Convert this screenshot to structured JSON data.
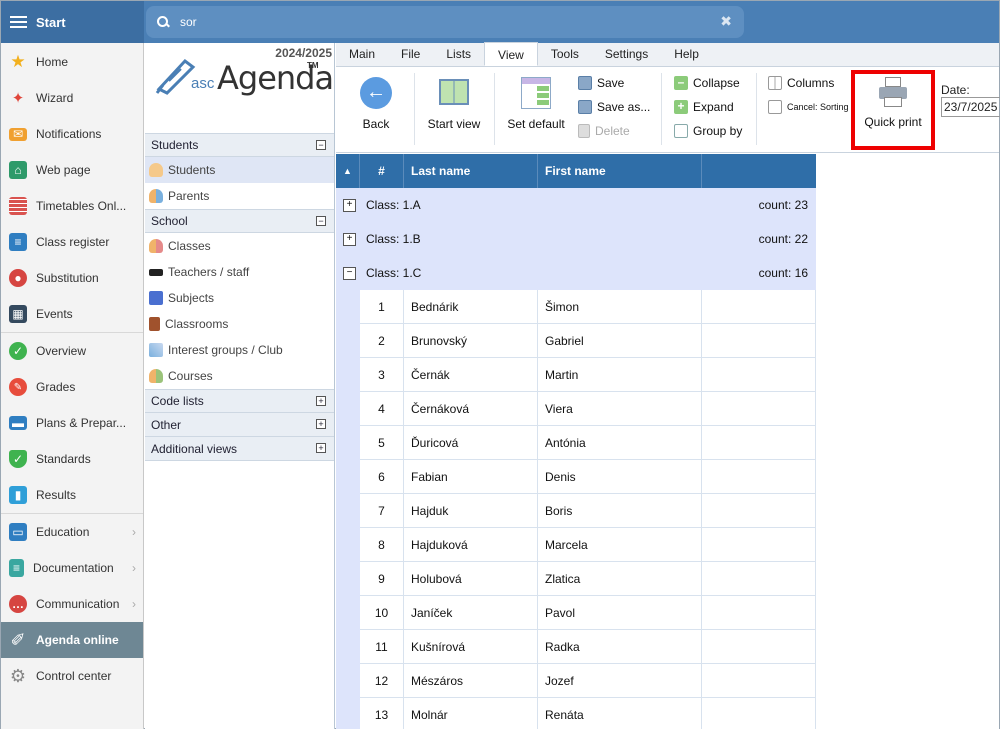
{
  "topbar": {
    "start_label": "Start",
    "search_value": "sor",
    "clear_glyph": "✖"
  },
  "leftnav": {
    "items": [
      {
        "label": "Home",
        "icon": "star-icon",
        "color": "#f2b01e"
      },
      {
        "label": "Wizard",
        "icon": "wand-icon",
        "color": "#e0453a"
      },
      {
        "label": "Notifications",
        "icon": "envelope-icon",
        "color": "#f0a030"
      },
      {
        "label": "Web page",
        "icon": "house-icon",
        "color": "#2e9a6a"
      },
      {
        "label": "Timetables Onl...",
        "icon": "timetable-icon",
        "color": "#d9534f"
      },
      {
        "label": "Class register",
        "icon": "book-icon",
        "color": "#2f7ec1"
      },
      {
        "label": "Substitution",
        "icon": "person-icon",
        "color": "#d64541"
      },
      {
        "label": "Events",
        "icon": "calendar-icon",
        "color": "#34495e"
      },
      {
        "label": "Overview",
        "icon": "check-circle-icon",
        "color": "#3fb34f"
      },
      {
        "label": "Grades",
        "icon": "grades-icon",
        "color": "#e74c3c"
      },
      {
        "label": "Plans & Prepar...",
        "icon": "briefcase-icon",
        "color": "#2f7ec1"
      },
      {
        "label": "Standards",
        "icon": "shield-icon",
        "color": "#3fb34f"
      },
      {
        "label": "Results",
        "icon": "bar-chart-icon",
        "color": "#2f9fd8"
      },
      {
        "label": "Education",
        "icon": "open-book-icon",
        "color": "#2f7ec1"
      },
      {
        "label": "Documentation",
        "icon": "document-icon",
        "color": "#3aa7a0"
      },
      {
        "label": "Communication",
        "icon": "chat-icon",
        "color": "#d64541"
      },
      {
        "label": "Agenda online",
        "icon": "pen-icon",
        "color": "#ffffff"
      },
      {
        "label": "Control center",
        "icon": "gear-icon",
        "color": "#888888"
      }
    ]
  },
  "sidepanel": {
    "year": "2024/2025",
    "logo_asc": "asc",
    "logo_agenda": "Agenda",
    "logo_tm": "TM",
    "sections": {
      "students": {
        "title": "Students",
        "toggle": "−",
        "items": [
          "Students",
          "Parents"
        ]
      },
      "school": {
        "title": "School",
        "toggle": "−",
        "items": [
          "Classes",
          "Teachers / staff",
          "Subjects",
          "Classrooms",
          "Interest groups / Club",
          "Courses"
        ]
      },
      "code_lists": {
        "title": "Code lists",
        "toggle": "+"
      },
      "other": {
        "title": "Other",
        "toggle": "+"
      },
      "additional": {
        "title": "Additional views",
        "toggle": "+"
      }
    }
  },
  "ribbon": {
    "tabs": [
      "Main",
      "File",
      "Lists",
      "View",
      "Tools",
      "Settings",
      "Help"
    ],
    "back": "Back",
    "start_view": "Start view",
    "set_default": "Set default",
    "save": "Save",
    "save_as": "Save as...",
    "delete": "Delete",
    "collapse": "Collapse",
    "expand": "Expand",
    "group_by": "Group by",
    "columns": "Columns",
    "cancel_sorting": "Cancel: Sorting",
    "quick_print": "Quick print",
    "date_label": "Date:",
    "date_value": "23/7/2025"
  },
  "grid": {
    "sort_arrow": "▲",
    "headers": {
      "num": "#",
      "last": "Last name",
      "first": "First name"
    },
    "groups": [
      {
        "label": "Class: 1.A",
        "count": "count: 23",
        "toggle": "+"
      },
      {
        "label": "Class: 1.B",
        "count": "count: 22",
        "toggle": "+"
      },
      {
        "label": "Class: 1.C",
        "count": "count: 16",
        "toggle": "−"
      }
    ],
    "rows": [
      {
        "num": "1",
        "last": "Bednárik",
        "first": "Šimon"
      },
      {
        "num": "2",
        "last": "Brunovský",
        "first": "Gabriel"
      },
      {
        "num": "3",
        "last": "Černák",
        "first": "Martin"
      },
      {
        "num": "4",
        "last": "Černáková",
        "first": "Viera"
      },
      {
        "num": "5",
        "last": "Ďuricová",
        "first": "Antónia"
      },
      {
        "num": "6",
        "last": "Fabian",
        "first": "Denis"
      },
      {
        "num": "7",
        "last": "Hajduk",
        "first": "Boris"
      },
      {
        "num": "8",
        "last": "Hajduková",
        "first": "Marcela"
      },
      {
        "num": "9",
        "last": "Holubová",
        "first": "Zlatica"
      },
      {
        "num": "10",
        "last": "Janíček",
        "first": "Pavol"
      },
      {
        "num": "11",
        "last": "Kušnírová",
        "first": "Radka"
      },
      {
        "num": "12",
        "last": "Mészáros",
        "first": "Jozef"
      },
      {
        "num": "13",
        "last": "Molnár",
        "first": "Renáta"
      }
    ]
  }
}
